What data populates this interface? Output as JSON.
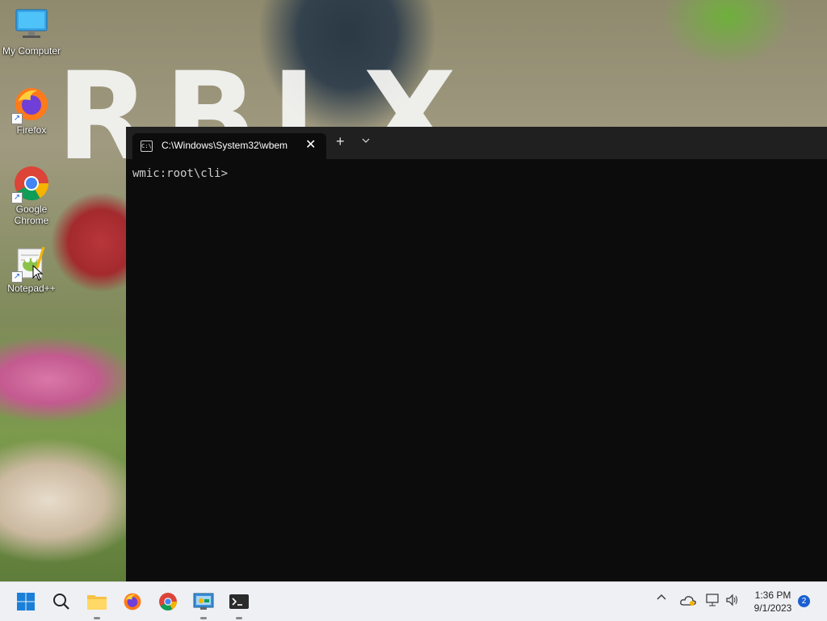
{
  "desktop": {
    "icons": [
      {
        "label": "My Computer",
        "icon": "monitor-icon"
      },
      {
        "label": "Firefox",
        "icon": "firefox-icon"
      },
      {
        "label": "Google\nChrome",
        "icon": "chrome-icon"
      },
      {
        "label": "Notepad++",
        "icon": "notepadpp-icon"
      }
    ]
  },
  "terminal": {
    "tab_title": "C:\\Windows\\System32\\wbem",
    "new_tab_label": "+",
    "dropdown_label": "⌄",
    "close_label": "✕",
    "prompt": "wmic:root\\cli>"
  },
  "taskbar": {
    "apps": [
      "start-icon",
      "search-icon",
      "file-explorer-icon",
      "firefox-icon",
      "chrome-icon",
      "control-panel-icon",
      "terminal-icon"
    ],
    "tray": {
      "chevron": "^",
      "time": "1:36 PM",
      "date": "9/1/2023",
      "notification_count": "2"
    }
  },
  "colors": {
    "terminal_bg": "#0c0c0c",
    "titlebar_bg": "#202020",
    "taskbar_bg": "#eef0f4",
    "accent": "#1a5fd1"
  }
}
